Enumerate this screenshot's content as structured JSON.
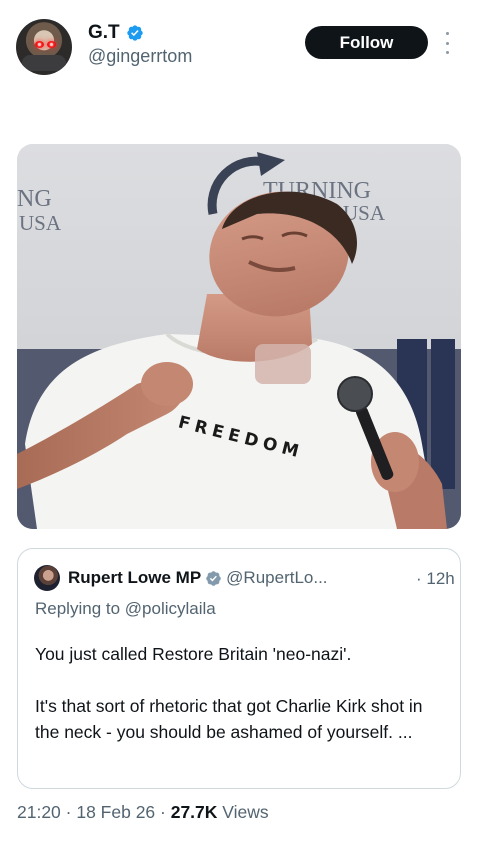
{
  "author": {
    "display_name": "G.T",
    "handle": "@gingerrtom",
    "verified": true
  },
  "actions": {
    "follow_label": "Follow",
    "more_icon": "more-vertical-icon"
  },
  "media": {
    "banner_text_left_1": "NG",
    "banner_text_left_2": "USA",
    "banner_text_right_1": "TURNING",
    "banner_text_right_2": "USA",
    "shirt_text": "FREEDOM"
  },
  "quoted_post": {
    "display_name": "Rupert Lowe MP",
    "handle": "@RupertLo...",
    "time": "· 12h",
    "verified": true,
    "replying_prefix": "Replying to ",
    "replying_to": "@policylaila",
    "paragraph_1": "You just called Restore Britain 'neo-nazi'.",
    "paragraph_2": "It's that sort of rhetoric that got Charlie Kirk shot in the neck - you should be ashamed of yourself. ..."
  },
  "meta": {
    "timestamp": "21:20 · 18 Feb 26 · ",
    "views_count": "27.7K",
    "views_label": " Views"
  },
  "colors": {
    "text": "#0f1419",
    "secondary": "#536471",
    "verified_blue": "#1d9bf0",
    "border": "#cfd9de",
    "follow_bg": "#0f1419"
  }
}
